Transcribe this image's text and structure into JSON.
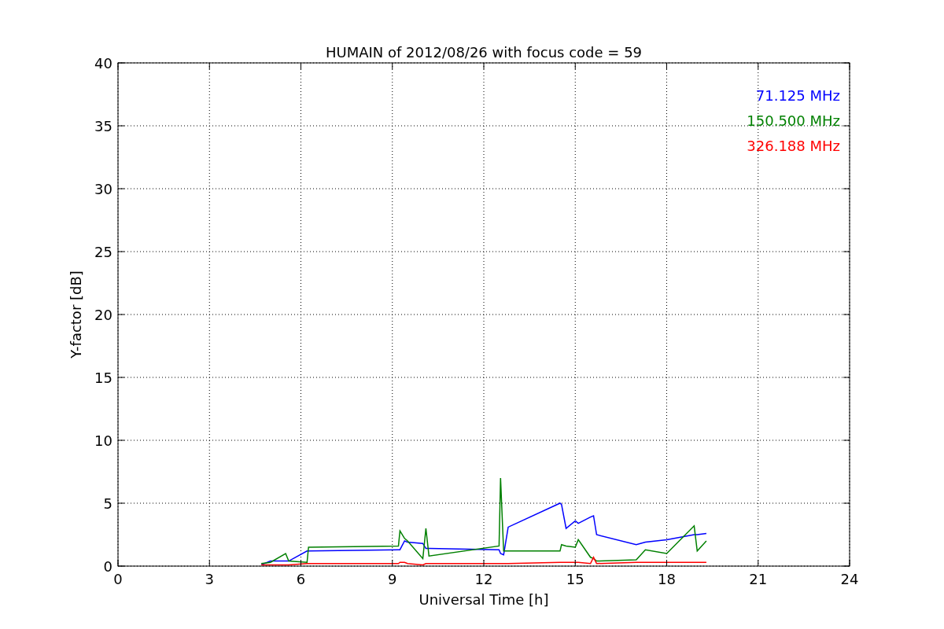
{
  "chart_data": {
    "type": "line",
    "title": "HUMAIN of 2012/08/26 with focus code = 59",
    "xlabel": "Universal Time [h]",
    "ylabel": "Y-factor [dB]",
    "x": [
      4.7,
      5.0,
      5.5,
      5.6,
      6.2,
      6.25,
      9.2,
      9.25,
      9.4,
      9.5,
      10.0,
      10.1,
      10.2,
      12.5,
      12.55,
      12.65,
      12.8,
      14.5,
      14.55,
      14.7,
      15.0,
      15.1,
      15.5,
      15.6,
      15.7,
      17.0,
      17.3,
      18.0,
      18.9,
      19.0,
      19.3
    ],
    "series": [
      {
        "name": "71.125 MHz",
        "color": "#0000ff",
        "values": [
          0.1,
          0.4,
          0.4,
          0.4,
          1.2,
          1.2,
          1.3,
          1.3,
          2.0,
          1.9,
          1.8,
          1.4,
          1.4,
          1.3,
          1.0,
          0.9,
          3.1,
          5.0,
          4.9,
          3.0,
          3.6,
          3.4,
          3.9,
          4.0,
          2.5,
          1.7,
          1.9,
          2.1,
          2.5,
          2.5,
          2.6
        ]
      },
      {
        "name": "150.500 MHz",
        "color": "#008000",
        "values": [
          0.2,
          0.3,
          1.0,
          0.4,
          0.3,
          1.5,
          1.6,
          2.8,
          2.2,
          2.0,
          0.6,
          3.0,
          0.8,
          1.6,
          7.0,
          1.2,
          1.2,
          1.2,
          1.7,
          1.6,
          1.5,
          2.1,
          0.7,
          0.6,
          0.4,
          0.5,
          1.3,
          1.0,
          3.2,
          1.2,
          2.0
        ]
      },
      {
        "name": "326.188 MHz",
        "color": "#ff0000",
        "values": [
          0.1,
          0.1,
          0.1,
          0.1,
          0.2,
          0.2,
          0.2,
          0.3,
          0.3,
          0.2,
          0.1,
          0.2,
          0.2,
          0.2,
          0.2,
          0.2,
          0.2,
          0.3,
          0.3,
          0.3,
          0.3,
          0.3,
          0.2,
          0.7,
          0.2,
          0.3,
          0.3,
          0.3,
          0.3,
          0.3,
          0.3
        ]
      }
    ],
    "grid": true,
    "xlim": [
      0,
      24
    ],
    "ylim": [
      0,
      40
    ],
    "xticks": [
      0,
      3,
      6,
      9,
      12,
      15,
      18,
      21,
      24
    ],
    "yticks": [
      0,
      5,
      10,
      15,
      20,
      25,
      30,
      35,
      40
    ]
  }
}
